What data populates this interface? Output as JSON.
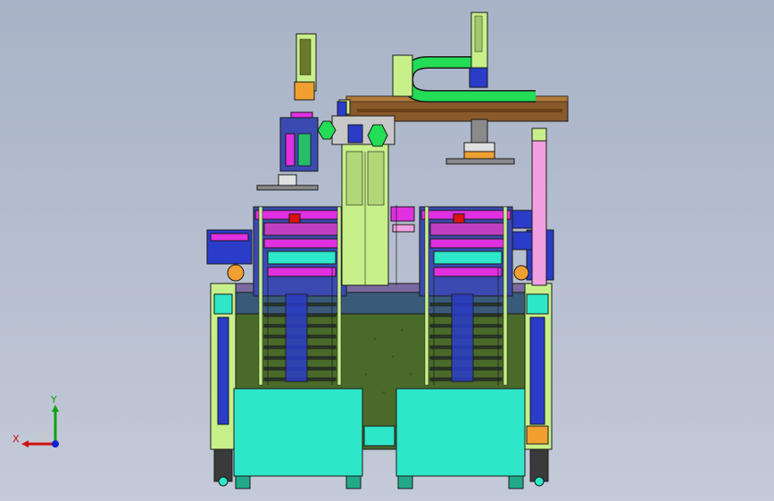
{
  "viewport": {
    "background_top": "#a9b3c7",
    "background_bottom": "#c3cad8"
  },
  "axis_triad": {
    "x_label": "X",
    "y_label": "Y",
    "x_color": "#d01010",
    "y_color": "#10a010",
    "z_color": "#1020d0"
  },
  "model_colors": {
    "cyan": "#2ee6c8",
    "green": "#22dd55",
    "olive": "#4a6a2a",
    "blue": "#2a3cc8",
    "magenta": "#e030e0",
    "brown": "#8a5a2a",
    "yellow_green": "#c8f08a",
    "orange": "#f0a030",
    "pink": "#f0a0e0",
    "gray": "#8a8a8a"
  }
}
